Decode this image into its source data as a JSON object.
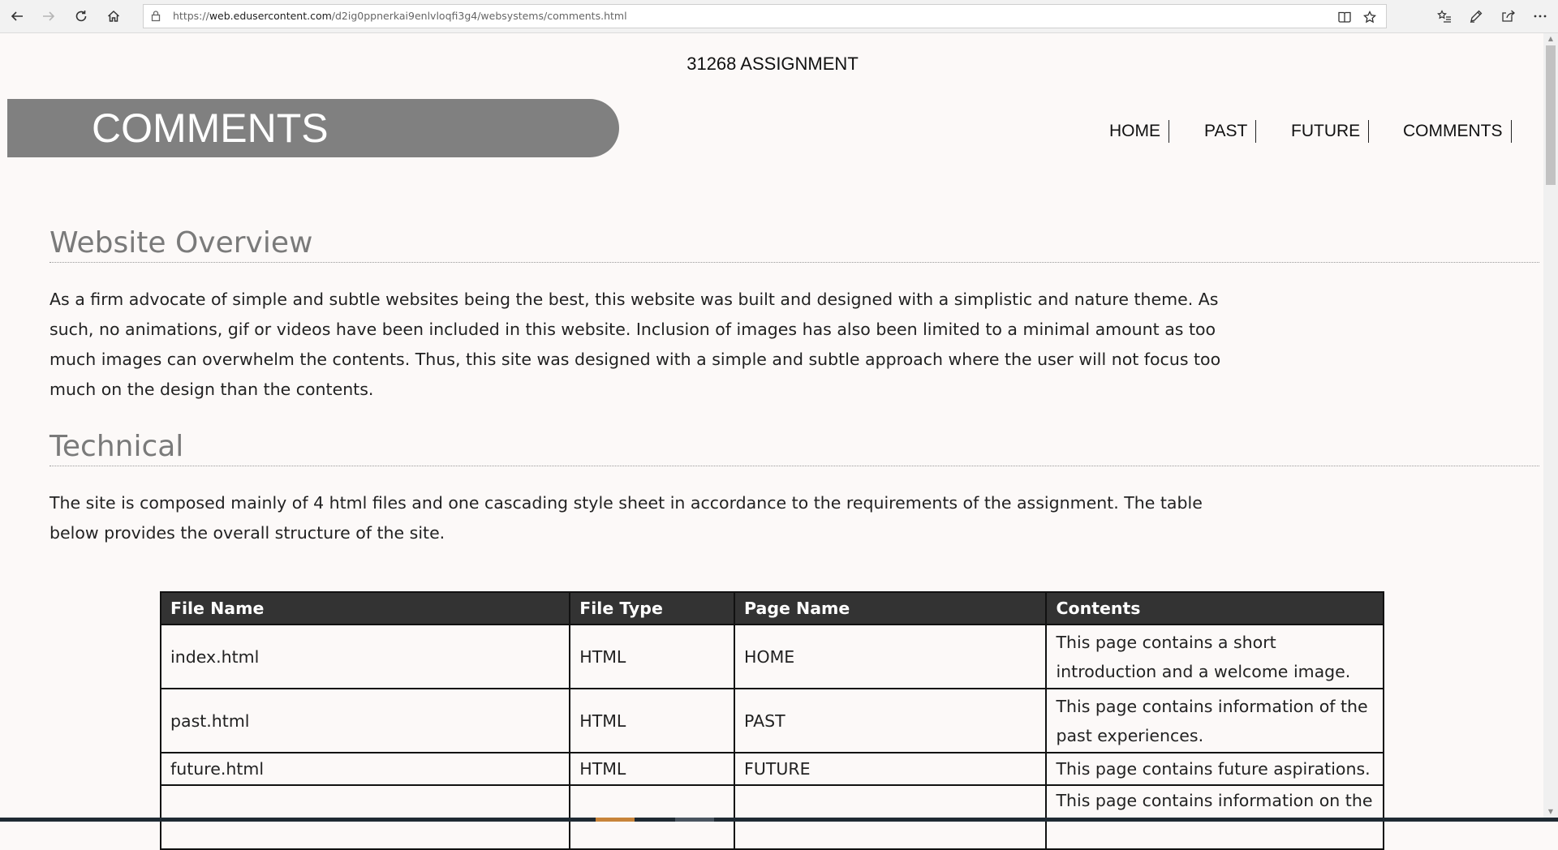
{
  "browser": {
    "url_prefix": "https://",
    "url_host": "web.edusercontent.com",
    "url_path": "/d2ig0ppnerkai9enlvloqfi3g4/websystems/comments.html"
  },
  "page": {
    "site_title": "31268 ASSIGNMENT",
    "banner_title": "COMMENTS",
    "nav": [
      "HOME",
      "PAST",
      "FUTURE",
      "COMMENTS"
    ],
    "overview": {
      "heading": "Website Overview",
      "lines": [
        "As a firm advocate of simple and subtle websites being the best, this website was built and designed with a simplistic and nature theme. As",
        "such, no animations, gif or videos have been included in this website. Inclusion of images has also been limited to a minimal amount as too",
        "much images can overwhelm the contents. Thus, this site was designed with a simple and subtle approach where the user will not focus too",
        "much on the design than the contents."
      ]
    },
    "technical": {
      "heading": "Technical",
      "lines": [
        "The site is composed mainly of 4 html files and one cascading style sheet in accordance to the requirements of the assignment. The table",
        "below provides the overall structure of the site."
      ]
    },
    "table": {
      "headers": [
        "File Name",
        "File Type",
        "Page Name",
        "Contents"
      ],
      "rows": [
        {
          "file": "index.html",
          "type": "HTML",
          "page": "HOME",
          "contents": [
            "This page contains a short",
            "introduction and a welcome image."
          ]
        },
        {
          "file": "past.html",
          "type": "HTML",
          "page": "PAST",
          "contents": [
            "This page contains information of the",
            "past experiences."
          ]
        },
        {
          "file": "future.html",
          "type": "HTML",
          "page": "FUTURE",
          "contents": [
            "This page contains future aspirations."
          ]
        },
        {
          "file": "",
          "type": "",
          "page": "",
          "contents": [
            "This page contains information on the",
            ""
          ]
        }
      ]
    }
  }
}
